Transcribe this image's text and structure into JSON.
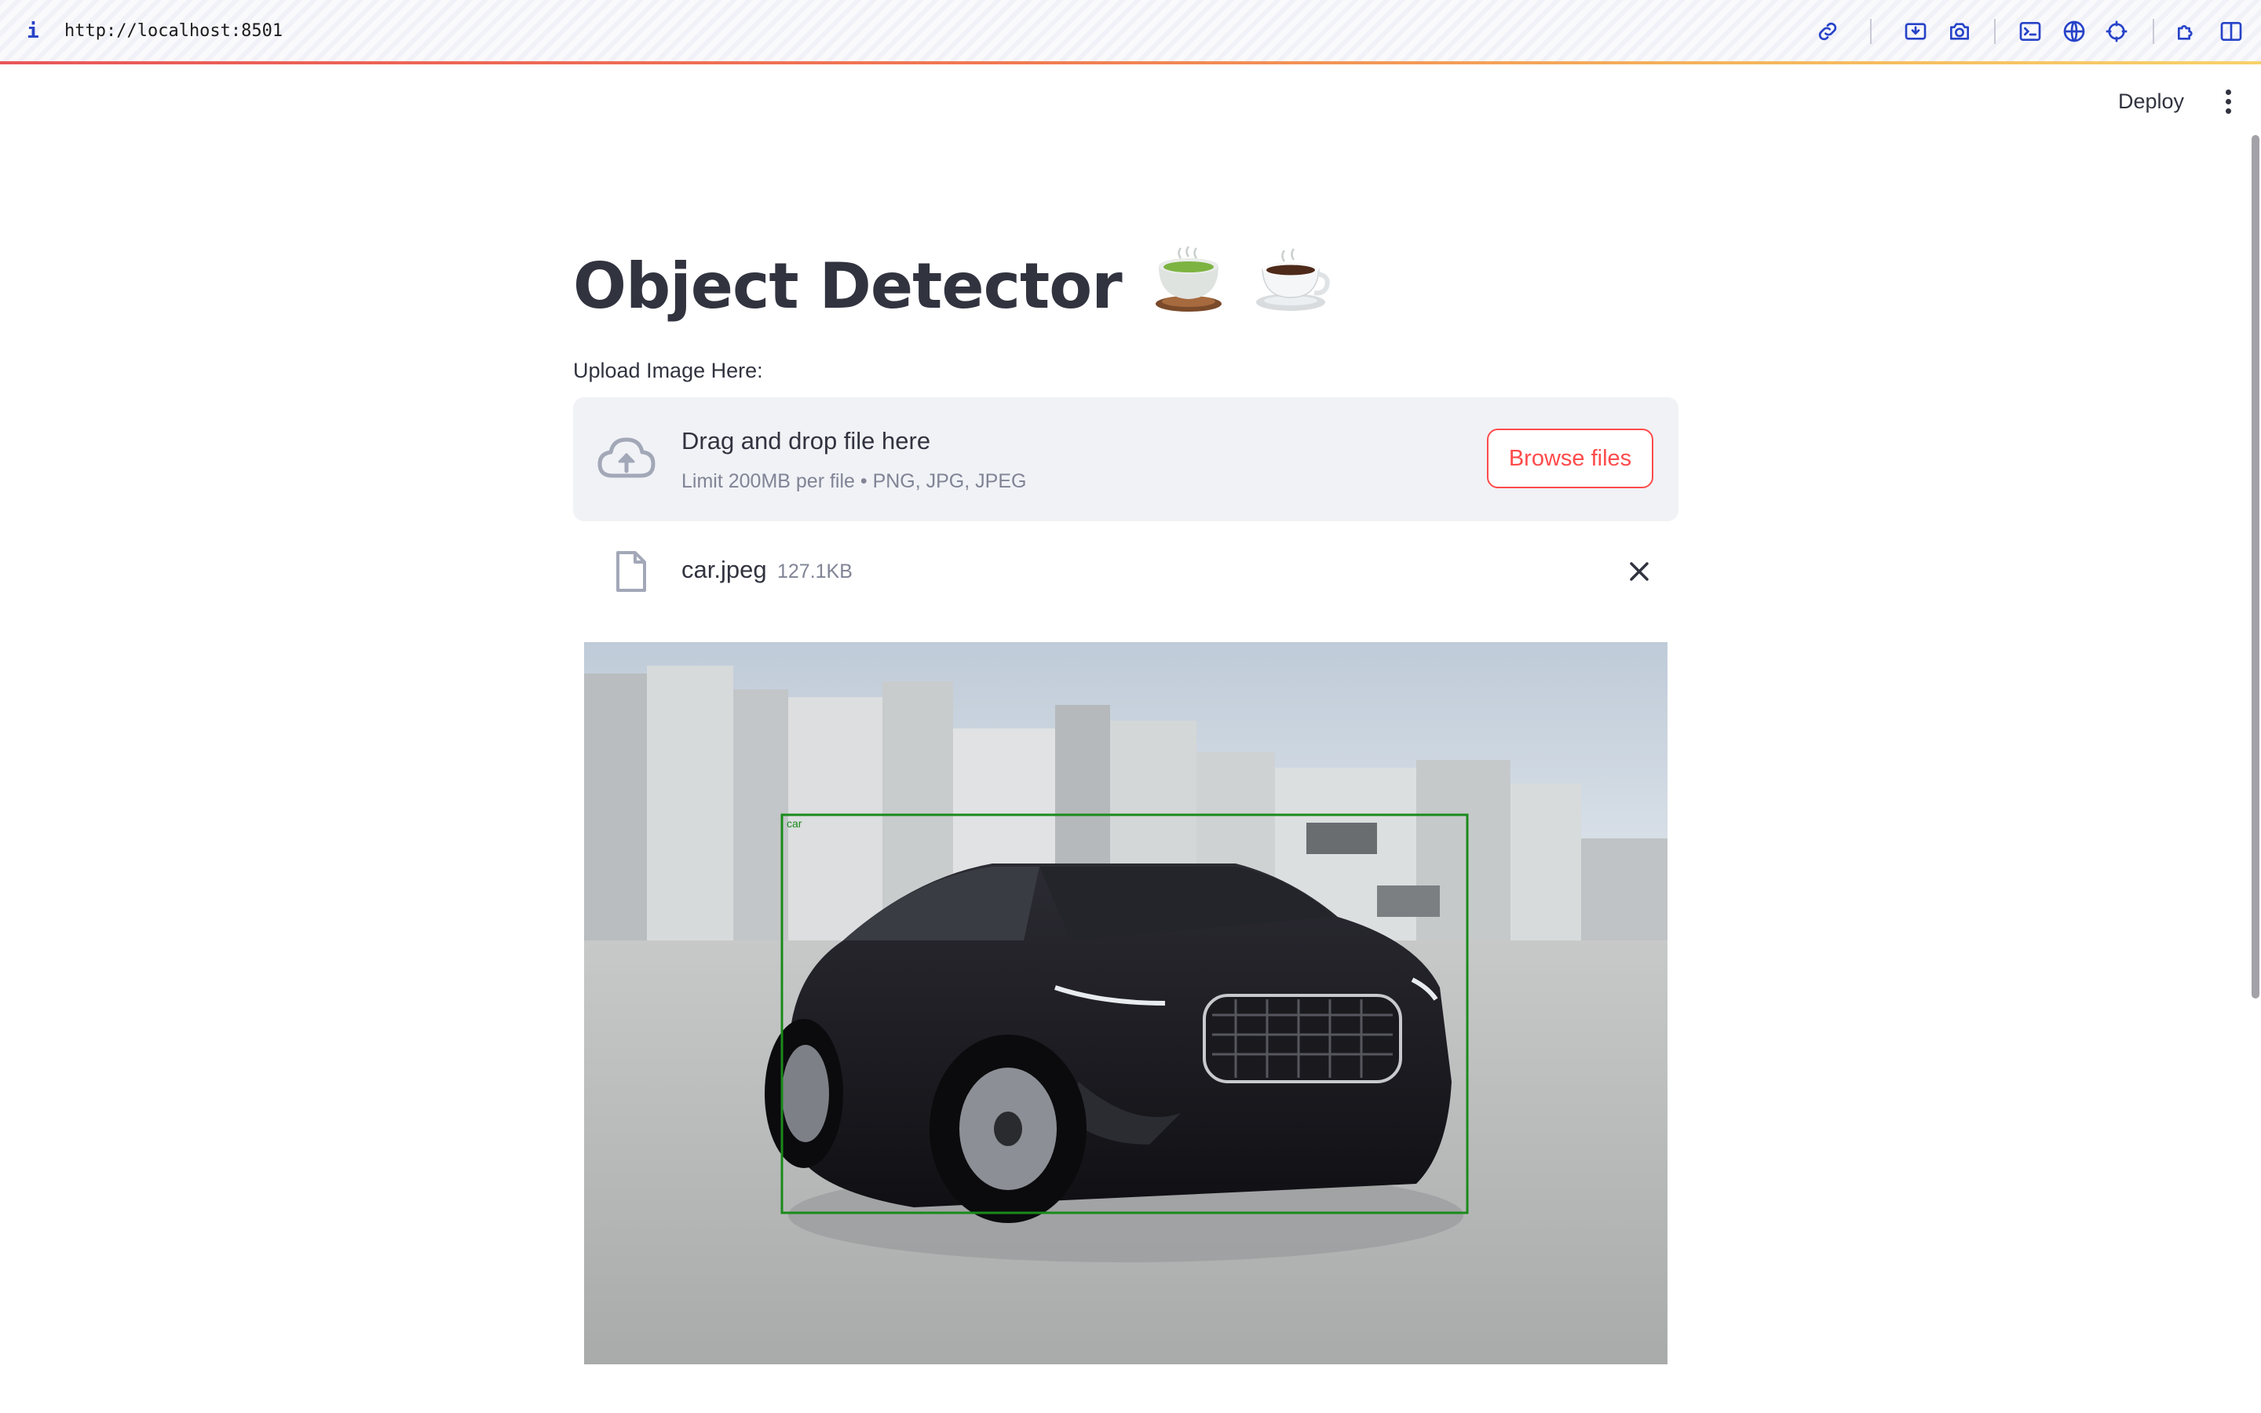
{
  "browser": {
    "url": "http://localhost:8501",
    "info_icon": "i",
    "toolbar_icons": [
      "link-icon",
      "screenshot-icon",
      "camera-icon",
      "terminal-icon",
      "globe-icon",
      "crosshair-icon",
      "extensions-icon",
      "sidebar-toggle-icon"
    ],
    "accent_colors": [
      "#e8575a",
      "#f07a52",
      "#f5b25c",
      "#f7d26a"
    ]
  },
  "header": {
    "deploy_label": "Deploy",
    "menu_icon": "more-vertical-icon"
  },
  "main": {
    "title": "Object Detector",
    "title_emojis": [
      "tea-cup-emoji",
      "coffee-cup-emoji"
    ],
    "uploader": {
      "label": "Upload Image Here:",
      "drop_title": "Drag and drop file here",
      "limit_text": "Limit 200MB per file • PNG, JPG, JPEG",
      "browse_label": "Browse files",
      "accent_color": "#ff4b4b"
    },
    "uploaded_file": {
      "name": "car.jpeg",
      "size": "127.1KB"
    },
    "detection": {
      "label": "car",
      "box_color": "#1a8a1a"
    }
  }
}
